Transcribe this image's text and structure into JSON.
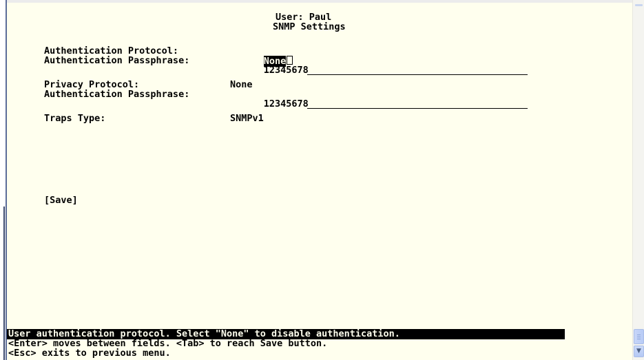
{
  "header": {
    "user": "User: Paul",
    "title": "SNMP Settings"
  },
  "fields": {
    "auth_protocol": {
      "label": "Authentication Protocol:",
      "value": "None"
    },
    "auth_passphrase": {
      "label": "Authentication Passphrase:",
      "value": "12345678"
    },
    "privacy_protocol": {
      "label": "Privacy Protocol:",
      "value": "None"
    },
    "privacy_passphrase": {
      "label": "Authentication Passphrase:",
      "value": "12345678"
    },
    "traps_type": {
      "label": "Traps Type:",
      "value": "SNMPv1"
    }
  },
  "save_button": "[Save]",
  "status_line": "User authentication protocol. Select \"None\" to disable authentication.",
  "help": {
    "line1": "<Enter> moves between fields. <Tab> to reach Save button.",
    "line2": "<Esc> exits to previous menu."
  },
  "colors": {
    "terminal_bg": "#ffffee",
    "text": "#000000",
    "highlight_bg": "#000000",
    "window_border": "#5a6b98"
  },
  "icons": {
    "scroll_down": "chevron-down-icon"
  }
}
